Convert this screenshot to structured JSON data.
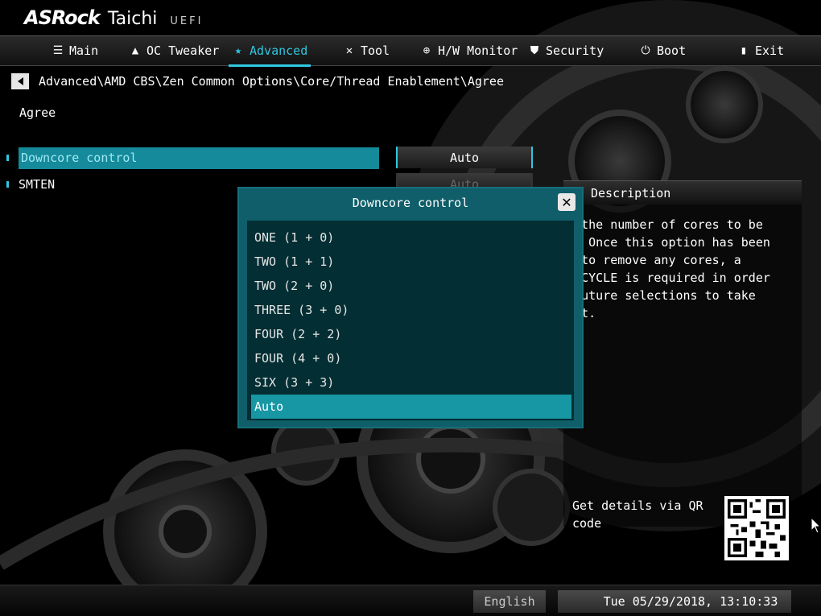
{
  "brand": {
    "name": "ASRock",
    "model": "Taichi",
    "suffix": "UEFI"
  },
  "menu": [
    {
      "label": "Main",
      "icon": "list-icon"
    },
    {
      "label": "OC Tweaker",
      "icon": "rocket-icon"
    },
    {
      "label": "Advanced",
      "icon": "star-icon",
      "active": true
    },
    {
      "label": "Tool",
      "icon": "tools-icon"
    },
    {
      "label": "H/W Monitor",
      "icon": "crosshair-icon"
    },
    {
      "label": "Security",
      "icon": "shield-icon"
    },
    {
      "label": "Boot",
      "icon": "power-icon"
    },
    {
      "label": "Exit",
      "icon": "exit-door-icon"
    }
  ],
  "breadcrumb": "Advanced\\AMD CBS\\Zen Common Options\\Core/Thread Enablement\\Agree",
  "section_title": "Agree",
  "settings": [
    {
      "label": "Downcore control",
      "value": "Auto",
      "selected": true
    },
    {
      "label": "SMTEN",
      "value": "Auto"
    }
  ],
  "description": {
    "header": "Description",
    "lines": [
      "ts the number of cores to be",
      "ed. Once this option has been",
      "ed to remove any cores, a",
      "ER CYCLE is required in order",
      "r future selections to take",
      "fect."
    ],
    "qr_text": "Get details via QR code"
  },
  "popup": {
    "title": "Downcore control",
    "options": [
      "ONE (1 + 0)",
      "TWO (1 + 1)",
      "TWO (2 + 0)",
      "THREE (3 + 0)",
      "FOUR (2 + 2)",
      "FOUR (4 + 0)",
      "SIX (3 + 3)",
      "Auto"
    ],
    "selected_index": 7
  },
  "footer": {
    "language": "English",
    "datetime": "Tue 05/29/2018, 13:10:33"
  },
  "colors": {
    "accent": "#30c6e0",
    "popup_bg": "#0f5e69",
    "list_bg": "#032e33",
    "selected": "#1796a4"
  }
}
